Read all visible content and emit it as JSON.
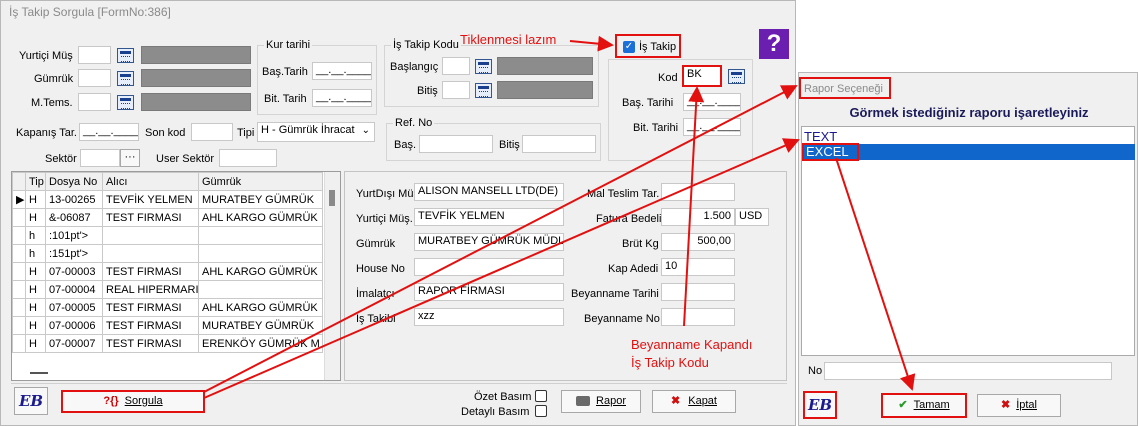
{
  "main_window": {
    "title": "İş Takip Sorgula [FormNo:386]",
    "help_label": "?",
    "filters": {
      "yurtici_mus_label": "Yurtiçi Müş",
      "gumruk_label": "Gümrük",
      "mtems_label": "M.Tems.",
      "kur_tarihi_label": "Kur tarihi",
      "bas_tarih_label": "Baş.Tarih",
      "bit_tarih_label": "Bit. Tarih",
      "date_placeholder": "__.__.____",
      "is_takip_kodu_label": "İş Takip Kodu",
      "baslangic_label": "Başlangıç",
      "bitis_label": "Bitiş",
      "is_takip_checkbox_label": "İş Takip",
      "kod_label": "Kod",
      "kod_value": "BK",
      "bas_tarihi_label": "Baş. Tarihi",
      "bit_tarihi_label": "Bit. Tarihi",
      "date_placeholder_short": "__.__.____",
      "kapanis_tar_label": "Kapanış Tar.",
      "son_kod_label": "Son kod",
      "tipi_label": "Tipi",
      "tipi_value": "H - Gümrük İhracat",
      "ref_no_label": "Ref. No",
      "bas_label": "Baş.",
      "bitis2_label": "Bitiş",
      "sektor_label": "Sektör",
      "sektor_button": "···",
      "user_sektor_label": "User Sektör"
    },
    "grid": {
      "columns": [
        "Tip",
        "Dosya No",
        "Alıcı",
        "Gümrük"
      ],
      "rows": [
        {
          "marker": "▶",
          "tip": "H",
          "dosya": "13-00265",
          "alici": "TEVFİK YELMEN",
          "gumruk": "MURATBEY GÜMRÜK"
        },
        {
          "marker": "",
          "tip": "H",
          "dosya": "&-06087",
          "alici": "TEST FIRMASI",
          "gumruk": "AHL KARGO GÜMRÜK"
        },
        {
          "marker": "",
          "tip": "h",
          "dosya": ":101pt'>",
          "alici": "",
          "gumruk": ""
        },
        {
          "marker": "",
          "tip": "h",
          "dosya": ":151pt'>",
          "alici": "",
          "gumruk": ""
        },
        {
          "marker": "",
          "tip": "H",
          "dosya": "07-00003",
          "alici": "TEST FIRMASI",
          "gumruk": "AHL KARGO GÜMRÜK"
        },
        {
          "marker": "",
          "tip": "H",
          "dosya": "07-00004",
          "alici": "REAL HIPERMARI",
          "gumruk": ""
        },
        {
          "marker": "",
          "tip": "H",
          "dosya": "07-00005",
          "alici": "TEST FIRMASI",
          "gumruk": "AHL KARGO GÜMRÜK"
        },
        {
          "marker": "",
          "tip": "H",
          "dosya": "07-00006",
          "alici": "TEST FIRMASI",
          "gumruk": "MURATBEY GÜMRÜK"
        },
        {
          "marker": "",
          "tip": "H",
          "dosya": "07-00007",
          "alici": "TEST FIRMASI",
          "gumruk": "ERENKÖY GÜMRÜK M"
        }
      ]
    },
    "details": {
      "yurtdisi_mus_label": "YurtDışı Müş",
      "yurtdisi_mus_value": "ALISON MANSELL LTD(DE)",
      "yurtici_mus_label": "Yurtiçi Müş.",
      "yurtici_mus_value": "TEVFİK YELMEN",
      "gumruk_label": "Gümrük",
      "gumruk_value": "MURATBEY GÜMRÜK MÜDL",
      "house_no_label": "House No",
      "house_no_value": "",
      "imalatci_label": "İmalatçı",
      "imalatci_value": "RAPOR FİRMASI",
      "is_takibi_label": "İş Takibi",
      "is_takibi_value": "xzz",
      "mal_teslim_label": "Mal Teslim Tar.",
      "mal_teslim_value": "",
      "fatura_bedeli_label": "Fatura Bedeli",
      "fatura_bedeli_value": "1.500",
      "currency": "USD",
      "brut_kg_label": "Brüt Kg",
      "brut_kg_value": "500,00",
      "kap_adedi_label": "Kap Adedi",
      "kap_adedi_value": "10",
      "beyanname_tarihi_label": "Beyanname Tarihi",
      "beyanname_tarihi_value": "",
      "beyanname_no_label": "Beyanname No",
      "beyanname_no_value": ""
    },
    "footer": {
      "logo": "EB",
      "sorgula_label": "Sorgula",
      "sorgula_icon": "?{}",
      "ozet_basim_label": "Özet Basım",
      "detayli_basim_label": "Detaylı Basım",
      "rapor_label": "Rapor",
      "kapat_label": "Kapat"
    }
  },
  "annotations": {
    "tiklenmesi": "Tiklenmesi lazım",
    "beyanname_line1": "Beyanname Kapandı",
    "beyanname_line2": "İş Takip Kodu",
    "accent_color": "#e31010"
  },
  "report_dialog": {
    "title": "Rapor Seçeneği",
    "header": "Görmek istediğiniz raporu işaretleyiniz",
    "options": [
      "TEXT",
      "EXCEL"
    ],
    "selected": "EXCEL",
    "selection_color": "#1166cc",
    "no_label": "No",
    "no_value": "",
    "logo": "EB",
    "tamam_label": "Tamam",
    "iptal_label": "İptal"
  }
}
